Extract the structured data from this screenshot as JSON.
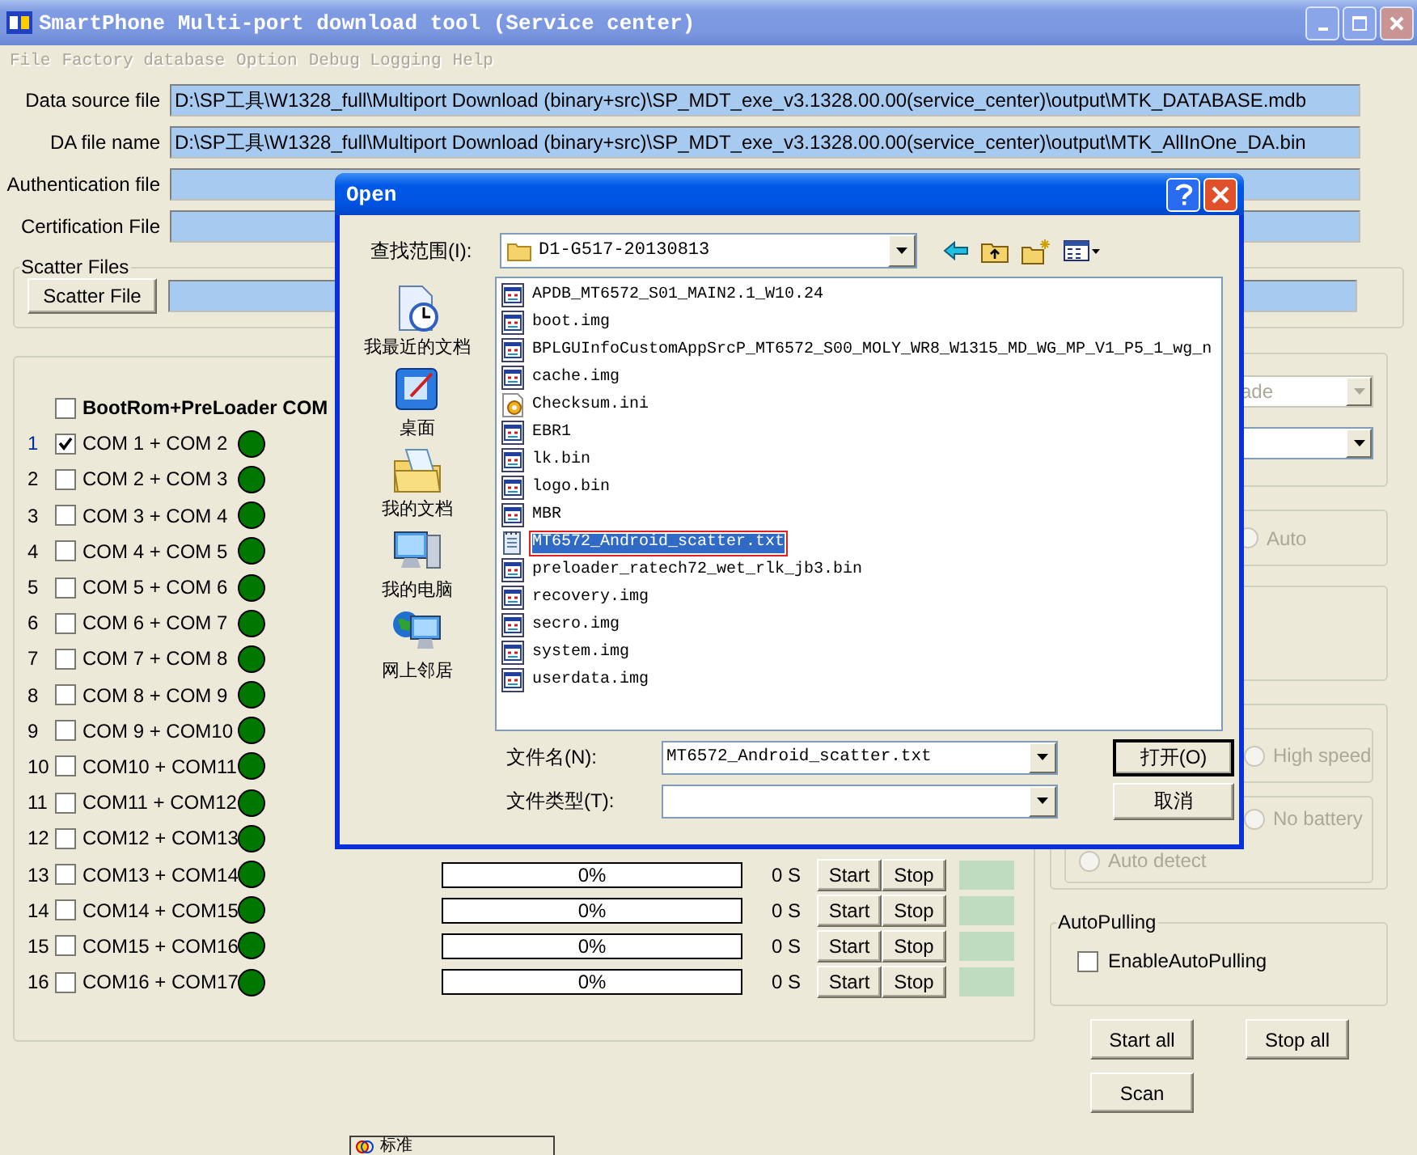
{
  "window": {
    "title": "SmartPhone Multi-port download tool (Service center)"
  },
  "menu": [
    {
      "label": "File",
      "disabled": true
    },
    {
      "label": "Factory database",
      "disabled": true
    },
    {
      "label": "Option",
      "disabled": true
    },
    {
      "label": "Debug Logging",
      "disabled": true
    },
    {
      "label": "Help",
      "disabled": true
    }
  ],
  "files": [
    {
      "label": "Data source file",
      "value": "D:\\SP工具\\W1328_full\\Multiport Download (binary+src)\\SP_MDT_exe_v3.1328.00.00(service_center)\\output\\MTK_DATABASE.mdb"
    },
    {
      "label": "DA file name",
      "value": "D:\\SP工具\\W1328_full\\Multiport Download (binary+src)\\SP_MDT_exe_v3.1328.00.00(service_center)\\output\\MTK_AllInOne_DA.bin"
    },
    {
      "label": "Authentication file"
    },
    {
      "label": "Certification File"
    }
  ],
  "scatter": {
    "title": "Scatter Files",
    "button": "Scatter File"
  },
  "ports": {
    "header": {
      "label": "BootRom+PreLoader COM",
      "checked": false
    },
    "rows": [
      {
        "index": "1",
        "label": "COM 1 + COM 2",
        "checked": true,
        "selected": true
      },
      {
        "index": "2",
        "label": "COM 2 + COM 3",
        "checked": false,
        "selected": false
      },
      {
        "index": "3",
        "label": "COM 3 + COM 4",
        "checked": false,
        "selected": false
      },
      {
        "index": "4",
        "label": "COM 4 + COM 5",
        "checked": false,
        "selected": false
      },
      {
        "index": "5",
        "label": "COM 5 + COM 6",
        "checked": false,
        "selected": false
      },
      {
        "index": "6",
        "label": "COM 6 + COM 7",
        "checked": false,
        "selected": false
      },
      {
        "index": "7",
        "label": "COM 7 + COM 8",
        "checked": false,
        "selected": false
      },
      {
        "index": "8",
        "label": "COM 8 + COM 9",
        "checked": false,
        "selected": false
      },
      {
        "index": "9",
        "label": "COM 9 + COM10",
        "checked": false,
        "selected": false
      },
      {
        "index": "10",
        "label": "COM10 + COM11",
        "checked": false,
        "selected": false
      },
      {
        "index": "11",
        "label": "COM11 + COM12",
        "checked": false,
        "selected": false
      },
      {
        "index": "12",
        "label": "COM12 + COM13",
        "checked": false,
        "selected": false
      },
      {
        "index": "13",
        "label": "COM13 + COM14",
        "checked": false,
        "selected": false,
        "progress": {
          "text": "0%",
          "level": 0,
          "time": "0 S",
          "start": "Start",
          "stop": "Stop"
        }
      },
      {
        "index": "14",
        "label": "COM14 + COM15",
        "checked": false,
        "selected": false,
        "progress": {
          "text": "0%",
          "level": 0,
          "time": "0 S",
          "start": "Start",
          "stop": "Stop"
        }
      },
      {
        "index": "15",
        "label": "COM15 + COM16",
        "checked": false,
        "selected": false,
        "progress": {
          "text": "0%",
          "level": 0,
          "time": "0 S",
          "start": "Start",
          "stop": "Stop"
        }
      },
      {
        "index": "16",
        "label": "COM16 + COM17",
        "checked": false,
        "selected": false,
        "progress": {
          "text": "0%",
          "level": 0,
          "time": "0 S",
          "start": "Start",
          "stop": "Stop"
        }
      }
    ]
  },
  "options": {
    "combos": [
      {
        "value": "ade",
        "disabled": true
      },
      {
        "disabled": false
      }
    ],
    "connection": {
      "label": "Auto",
      "disabled": true,
      "selected": false
    },
    "speed": [
      {
        "label": "High speed",
        "disabled": true,
        "selected": false
      },
      {
        "label": "No battery",
        "disabled": true,
        "selected": false
      },
      {
        "label": "Auto detect",
        "disabled": true,
        "selected": false
      }
    ],
    "autopulling": {
      "title": "AutoPulling",
      "label": "EnableAutoPulling",
      "checked": false
    },
    "buttons": [
      "Start all",
      "Stop all",
      "Scan"
    ]
  },
  "ime_bar": {
    "label": "标准"
  },
  "dialog": {
    "title": "Open",
    "look_in_label": "查找范围(I):",
    "look_in": "D1-G517-20130813",
    "places": [
      {
        "label": "我最近的文档",
        "kind": "recent"
      },
      {
        "label": "桌面",
        "kind": "desktop"
      },
      {
        "label": "我的文档",
        "kind": "documents"
      },
      {
        "label": "我的电脑",
        "kind": "computer"
      },
      {
        "label": "网上邻居",
        "kind": "network"
      }
    ],
    "files": [
      {
        "name": "APDB_MT6572_S01_MAIN2.1_W10.24",
        "kind": "file",
        "selected": false,
        "annotated": false
      },
      {
        "name": "boot.img",
        "kind": "file",
        "selected": false,
        "annotated": false
      },
      {
        "name": "BPLGUInfoCustomAppSrcP_MT6572_S00_MOLY_WR8_W1315_MD_WG_MP_V1_P5_1_wg_n",
        "kind": "file",
        "selected": false,
        "annotated": false
      },
      {
        "name": "cache.img",
        "kind": "file",
        "selected": false,
        "annotated": false
      },
      {
        "name": "Checksum.ini",
        "kind": "settings",
        "selected": false,
        "annotated": false
      },
      {
        "name": "EBR1",
        "kind": "file",
        "selected": false,
        "annotated": false
      },
      {
        "name": "lk.bin",
        "kind": "file",
        "selected": false,
        "annotated": false
      },
      {
        "name": "logo.bin",
        "kind": "file",
        "selected": false,
        "annotated": false
      },
      {
        "name": "MBR",
        "kind": "file",
        "selected": false,
        "annotated": false
      },
      {
        "name": "MT6572_Android_scatter.txt",
        "kind": "text",
        "selected": true,
        "annotated": true
      },
      {
        "name": "preloader_ratech72_wet_rlk_jb3.bin",
        "kind": "file",
        "selected": false,
        "annotated": false
      },
      {
        "name": "recovery.img",
        "kind": "file",
        "selected": false,
        "annotated": false
      },
      {
        "name": "secro.img",
        "kind": "file",
        "selected": false,
        "annotated": false
      },
      {
        "name": "system.img",
        "kind": "file",
        "selected": false,
        "annotated": false
      },
      {
        "name": "userdata.img",
        "kind": "file",
        "selected": false,
        "annotated": false
      }
    ],
    "filename_label": "文件名(N):",
    "filename": "MT6572_Android_scatter.txt",
    "filetype_label": "文件类型(T):",
    "buttons": [
      {
        "label": "打开(O)",
        "default": true
      },
      {
        "label": "取消",
        "default": false
      }
    ]
  }
}
